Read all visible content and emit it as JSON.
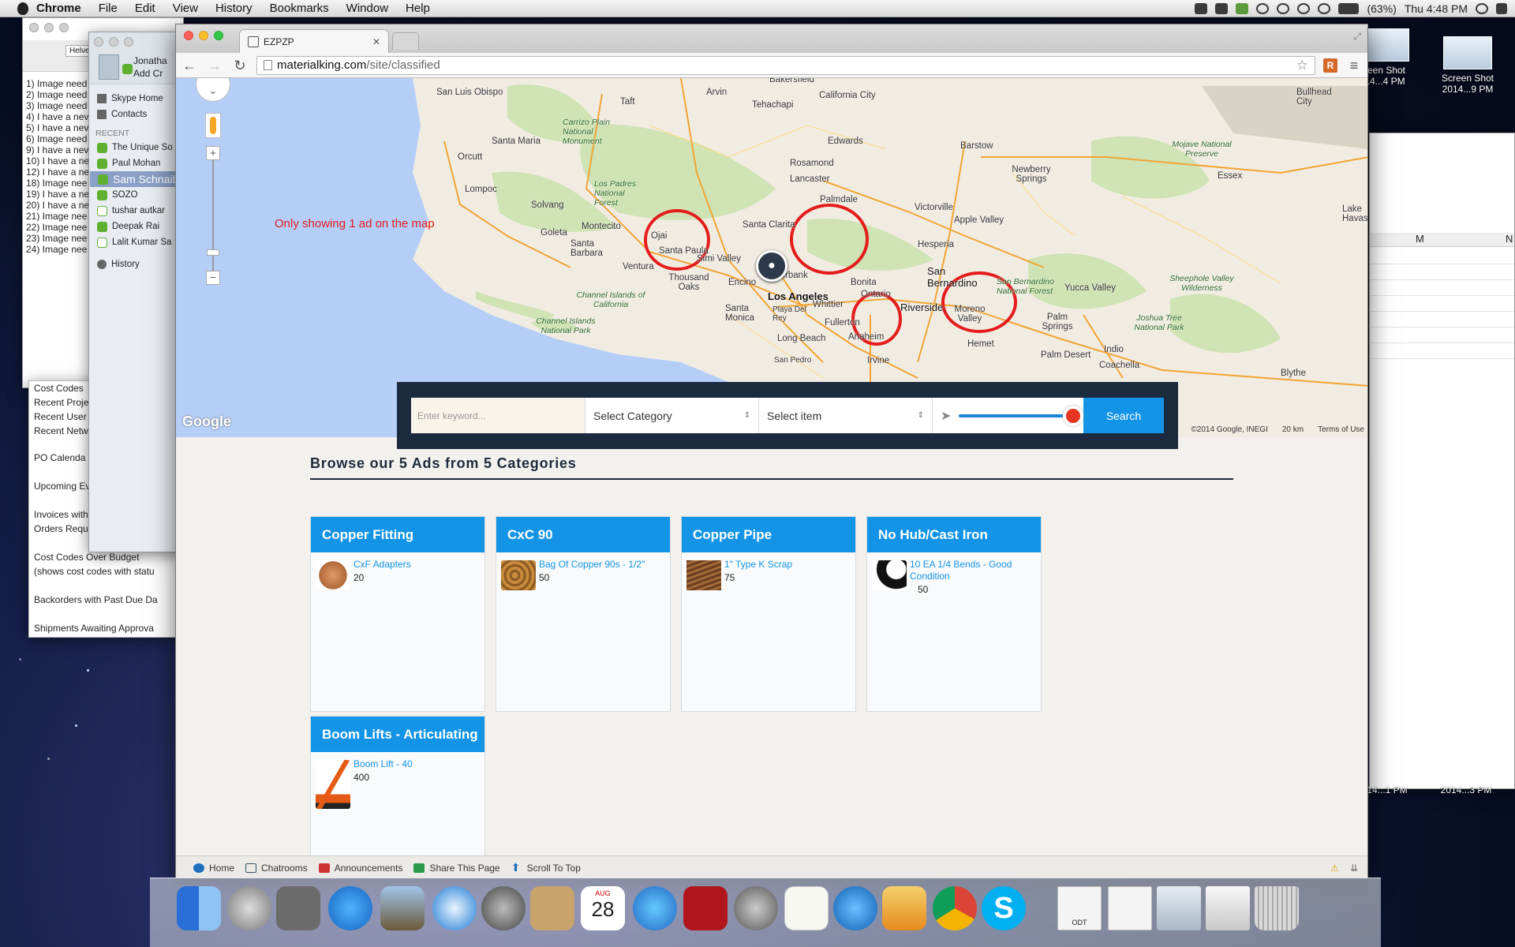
{
  "menubar": {
    "app": "Chrome",
    "items": [
      "File",
      "Edit",
      "View",
      "History",
      "Bookmarks",
      "Window",
      "Help"
    ],
    "battery": "(63%)",
    "clock": "Thu 4:48 PM"
  },
  "textedit": {
    "font_button": "Helvetica",
    "lines": [
      "1)  Image need",
      "2) Image need",
      "3) Image need",
      "4) I have a nev",
      "5) I have a nev",
      "6) Image need",
      "9) I have a nev",
      "10) I have a ne",
      "12) I have a ne",
      "18) Image nee",
      "19) I have a ne",
      "20) I have a ne",
      "21) Image nee",
      "22) Image nee",
      "23) Image nee",
      "24) Image nee"
    ]
  },
  "skype": {
    "user_name": "Jonatha",
    "user_sub": "Add Cr",
    "nav": [
      "Skype Home",
      "Contacts"
    ],
    "recent_label": "RECENT",
    "contacts": [
      {
        "name": "The Unique So",
        "online": true
      },
      {
        "name": "Paul Mohan",
        "online": true
      },
      {
        "name": "Sam Schnaible",
        "online": true
      },
      {
        "name": "SOZO",
        "online": true
      },
      {
        "name": "tushar autkar",
        "online": false
      },
      {
        "name": "Deepak Rai",
        "online": true
      },
      {
        "name": "Lalit Kumar Sa",
        "online": false
      }
    ],
    "history": "History"
  },
  "left_panel": [
    "Cost Codes",
    "Recent Proje",
    "Recent User",
    "Recent Netw",
    "PO Calenda",
    "Upcoming Ev",
    "Invoices with",
    "Orders Requ",
    "Cost Codes Over Budget",
    "(shows cost codes with statu",
    "Backorders with Past Due Da",
    "Shipments Awaiting Approva"
  ],
  "right_window": {
    "col_m": "M",
    "col_n": "N"
  },
  "desktop_icons": [
    {
      "label1": "reen Shot",
      "label2": "14...4 PM"
    },
    {
      "label1": "Screen Shot",
      "label2": "2014...9 PM"
    },
    {
      "label1": "14...1 PM",
      "label2": ""
    },
    {
      "label1": "2014...3 PM",
      "label2": ""
    }
  ],
  "browser": {
    "tab_title": "EZPZP",
    "url_domain": "materialking.com",
    "url_path": "/site/classified"
  },
  "map": {
    "note": "Only showing 1 ad on the map",
    "cities": [
      "San Luis Obispo",
      "Arvin",
      "Bakersfield",
      "Tehachapi",
      "California City",
      "Taft",
      "Carrizo Plain National Monument",
      "Edwards",
      "Santa Maria",
      "Orcutt",
      "Rosamond",
      "Lancaster",
      "Palmdale",
      "Lompoc",
      "Solvang",
      "Los Padres National Forest",
      "Santa Clarita",
      "Montecito",
      "Goleta",
      "Santa Barbara",
      "Ojai",
      "Santa Paula",
      "Ventura",
      "Simi Valley",
      "Thousand Oaks",
      "Encino",
      "Los Angeles",
      "Santa Monica",
      "Playa Del Rey",
      "Whittier",
      "Fullerton",
      "Anaheim",
      "Long Beach",
      "San Pedro",
      "Irvine",
      "Barstow",
      "Newberry Springs",
      "Victorville",
      "Apple Valley",
      "Hesperia",
      "San Bernardino",
      "Riverside",
      "Moreno Valley",
      "Hemet",
      "Palm Springs",
      "Palm Desert",
      "Indio",
      "Coachella",
      "Yucca Valley",
      "Essex",
      "Mojave National Preserve",
      "Bullhead City",
      "Sheephole Valley Wilderness",
      "Joshua Tree National Park",
      "Blythe",
      "Channel Islands of California",
      "Channel Islands National Park",
      "San Bernardino National Forest",
      "Bonita",
      "Ontario",
      "Burbank",
      "Lake Havasu"
    ],
    "google_logo": "Google",
    "copyright": "©2014 Google, INEGI",
    "scale": "20 km",
    "terms": "Terms of Use"
  },
  "search": {
    "keyword_placeholder": "Enter keyword...",
    "category": "Select Category",
    "item": "Select item",
    "button": "Search",
    "distance_level": 1.0
  },
  "browse": {
    "heading": "Browse our 5 Ads from 5 Categories",
    "categories": [
      {
        "name": "Copper Fitting",
        "item": "CxF Adapters",
        "qty": "20"
      },
      {
        "name": "CxC 90",
        "item": "Bag Of Copper 90s - 1/2\"",
        "qty": "50"
      },
      {
        "name": "Copper Pipe",
        "item": "1\" Type K Scrap",
        "qty": "75"
      },
      {
        "name": "No Hub/Cast Iron",
        "item": " 10 EA 1/4 Bends - Good Condition",
        "qty": "50"
      },
      {
        "name": "Boom Lifts - Articulating",
        "item": "Boom Lift - 40",
        "qty": "400"
      }
    ]
  },
  "bottombar": [
    "Home",
    "Chatrooms",
    "Announcements",
    "Share This Page",
    "Scroll To Top"
  ],
  "dock": {
    "calendar_month": "AUG",
    "calendar_day": "28",
    "doc_label": "ODT"
  }
}
